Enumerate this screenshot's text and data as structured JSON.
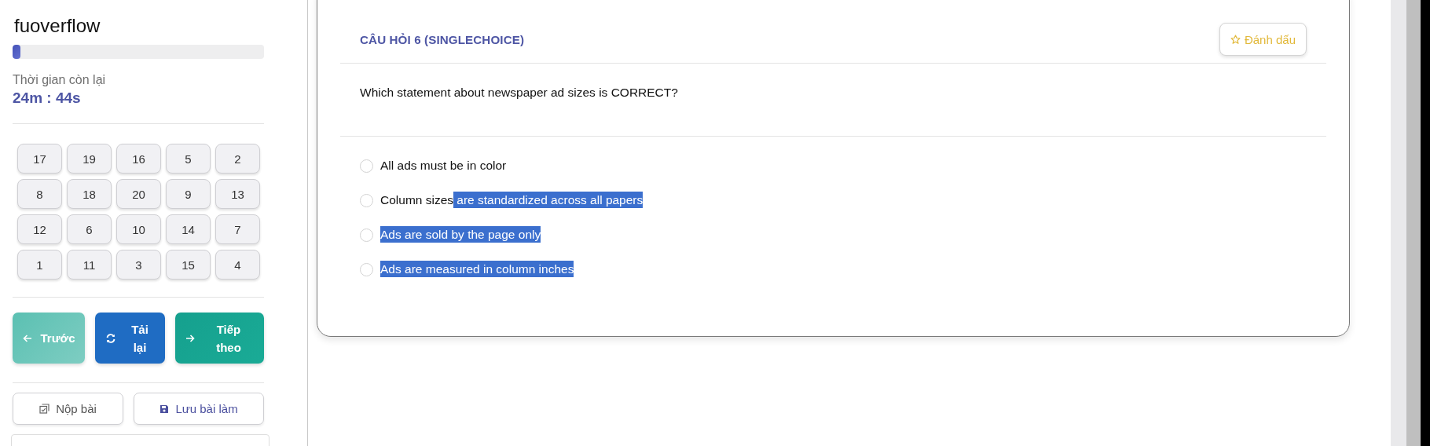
{
  "sidebar": {
    "brand": "fuoverflow",
    "progress": {
      "level": 0.03
    },
    "timer_label": "Thời gian còn lại",
    "timer_value": "24m : 44s",
    "question_numbers": [
      "17",
      "19",
      "16",
      "5",
      "2",
      "8",
      "18",
      "20",
      "9",
      "13",
      "12",
      "6",
      "10",
      "14",
      "7",
      "1",
      "11",
      "3",
      "15",
      "4"
    ],
    "nav_buttons": [
      {
        "kind": "previous",
        "label": "Trước"
      },
      {
        "kind": "reload",
        "label": "Tải lại"
      },
      {
        "kind": "next",
        "label": "Tiếp theo"
      }
    ],
    "actions": [
      {
        "kind": "submit",
        "label": "Nộp bài"
      },
      {
        "kind": "save",
        "label": "Lưu bài làm"
      }
    ]
  },
  "question": {
    "heading": "CÂU HỎI 6 (SINGLECHOICE)",
    "bookmark_button": "Đánh dấu",
    "text": "Which statement about newspaper ad sizes is CORRECT?",
    "options": [
      {
        "selected": false,
        "segments": [
          {
            "text": "All ads must be in color",
            "highlighted": false
          }
        ]
      },
      {
        "selected": false,
        "segments": [
          {
            "text": "Column sizes",
            "highlighted": false
          },
          {
            "text": " are standardized across all papers",
            "highlighted": true
          }
        ]
      },
      {
        "selected": false,
        "segments": [
          {
            "text": "Ads are sold by the page only",
            "highlighted": true
          }
        ]
      },
      {
        "selected": false,
        "segments": [
          {
            "text": "Ads are measured in column inches",
            "highlighted": true
          }
        ]
      }
    ]
  }
}
